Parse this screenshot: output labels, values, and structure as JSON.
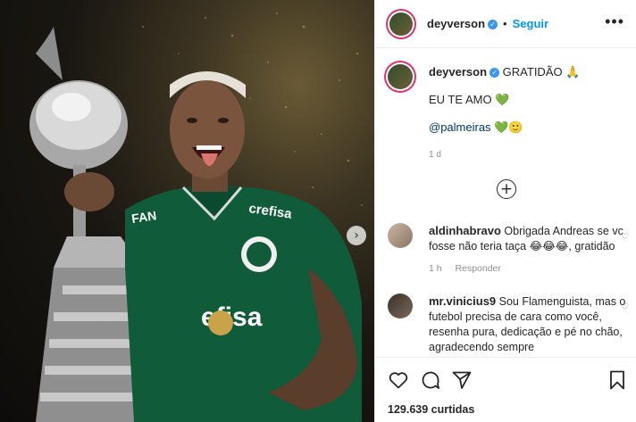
{
  "post": {
    "username": "deyverson",
    "follow_label": "Seguir",
    "more_label": "•••",
    "caption": {
      "line1": "GRATIDÃO",
      "line1_emoji": "🙏",
      "line2": "EU TE AMO",
      "line2_emoji": "💚",
      "mention": "@palmeiras",
      "mention_emoji": "💚🙂",
      "time": "1 d"
    },
    "comments": [
      {
        "username": "aldinhabravo",
        "text": "Obrigada Andreas se vc fosse não teria taça 😂😂😂, gratidão",
        "time": "1 h",
        "reply_label": "Responder"
      },
      {
        "username": "mr.vinicius9",
        "text": "Sou Flamenguista, mas o futebol precisa de cara como você, resenha pura, dedicação e pé no chão, agradecendo sempre"
      }
    ],
    "likes": "129.639 curtidas"
  },
  "colors": {
    "accent": "#0095f6",
    "verified": "#3897f0",
    "jersey": "#0f5b3a",
    "heart_green": "#2e9c2e"
  },
  "icons": {
    "verified": "verified-badge-icon",
    "like": "heart-icon",
    "comment": "comment-icon",
    "share": "paper-plane-icon",
    "save": "bookmark-icon",
    "more": "more-options-icon",
    "load_more": "plus-circle-icon",
    "next": "chevron-right-icon"
  }
}
